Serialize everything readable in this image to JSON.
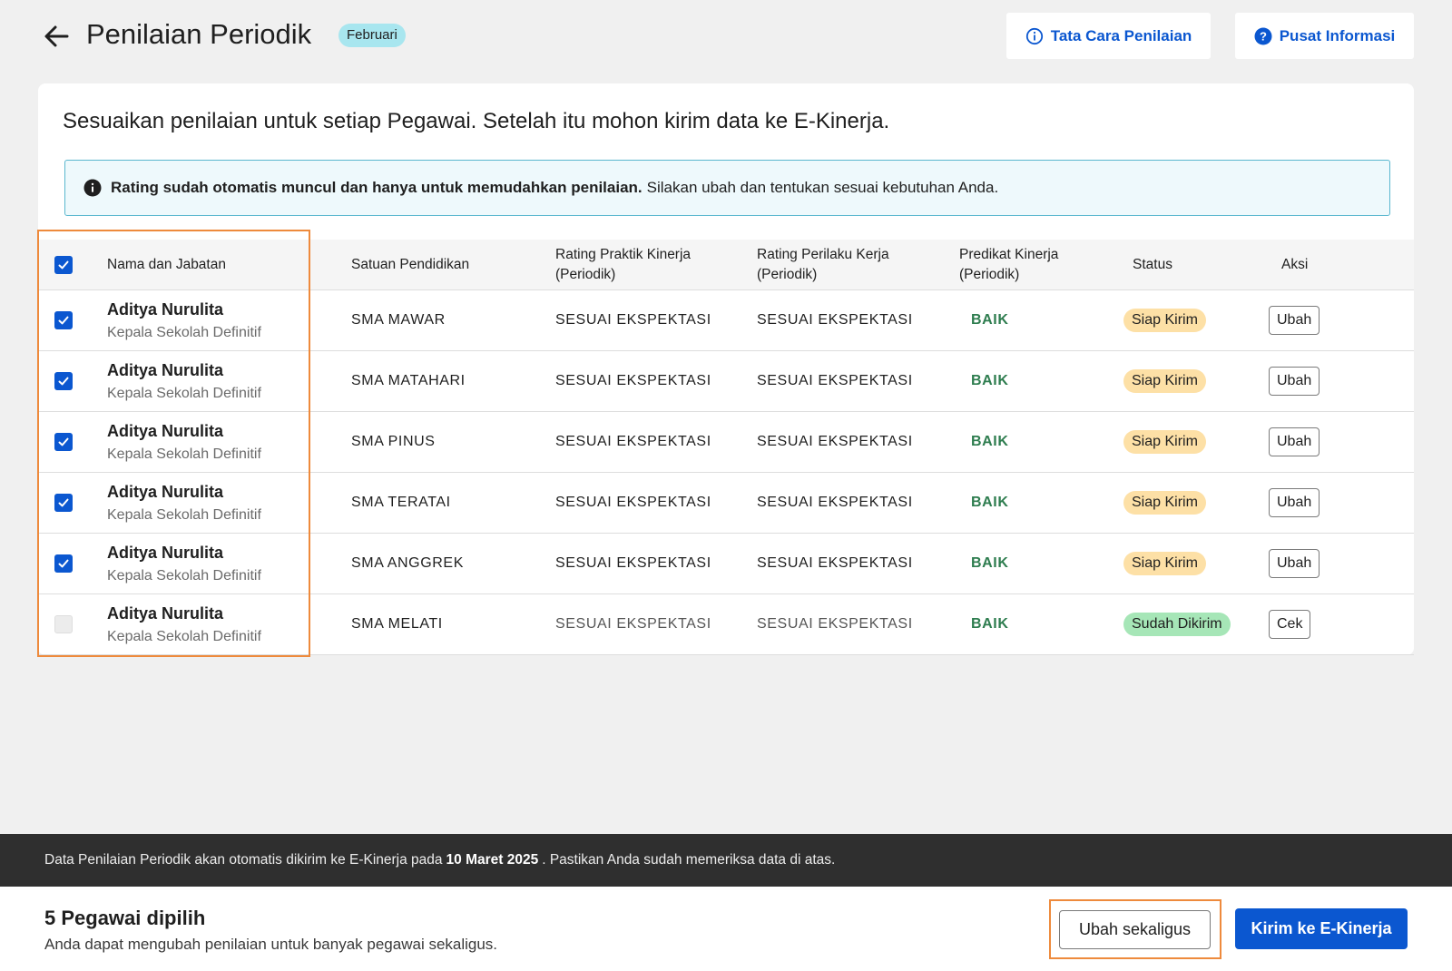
{
  "header": {
    "title": "Penilaian Periodik",
    "month_badge": "Februari",
    "tata_cara_label": "Tata Cara Penilaian",
    "pusat_informasi_label": "Pusat Informasi"
  },
  "card": {
    "heading": "Sesuaikan penilaian untuk setiap Pegawai. Setelah itu mohon kirim data ke E-Kinerja.",
    "info_bold": "Rating sudah otomatis muncul dan hanya untuk memudahkan penilaian.",
    "info_rest": "Silakan ubah dan tentukan sesuai kebutuhan Anda."
  },
  "table": {
    "headers": {
      "nama": "Nama dan Jabatan",
      "satuan": "Satuan Pendidikan",
      "rating_praktik_1": "Rating Praktik Kinerja",
      "rating_praktik_2": "(Periodik)",
      "rating_perilaku_1": "Rating Perilaku Kerja",
      "rating_perilaku_2": "(Periodik)",
      "predikat_1": "Predikat Kinerja",
      "predikat_2": "(Periodik)",
      "status": "Status",
      "aksi": "Aksi"
    },
    "header_checked": true,
    "rows": [
      {
        "name": "Aditya Nurulita",
        "role": "Kepala Sekolah Definitif",
        "school": "SMA MAWAR",
        "rating_praktik": "SESUAI EKSPEKTASI",
        "rating_perilaku": "SESUAI EKSPEKTASI",
        "predikat": "BAIK",
        "status": "Siap Kirim",
        "action": "Ubah",
        "checked": true
      },
      {
        "name": "Aditya Nurulita",
        "role": "Kepala Sekolah Definitif",
        "school": "SMA MATAHARI",
        "rating_praktik": "SESUAI EKSPEKTASI",
        "rating_perilaku": "SESUAI EKSPEKTASI",
        "predikat": "BAIK",
        "status": "Siap Kirim",
        "action": "Ubah",
        "checked": true
      },
      {
        "name": "Aditya Nurulita",
        "role": "Kepala Sekolah Definitif",
        "school": "SMA PINUS",
        "rating_praktik": "SESUAI EKSPEKTASI",
        "rating_perilaku": "SESUAI EKSPEKTASI",
        "predikat": "BAIK",
        "status": "Siap Kirim",
        "action": "Ubah",
        "checked": true
      },
      {
        "name": "Aditya Nurulita",
        "role": "Kepala Sekolah Definitif",
        "school": "SMA TERATAI",
        "rating_praktik": "SESUAI EKSPEKTASI",
        "rating_perilaku": "SESUAI EKSPEKTASI",
        "predikat": "BAIK",
        "status": "Siap Kirim",
        "action": "Ubah",
        "checked": true
      },
      {
        "name": "Aditya Nurulita",
        "role": "Kepala Sekolah Definitif",
        "school": "SMA ANGGREK",
        "rating_praktik": "SESUAI EKSPEKTASI",
        "rating_perilaku": "SESUAI EKSPEKTASI",
        "predikat": "BAIK",
        "status": "Siap Kirim",
        "action": "Ubah",
        "checked": true
      },
      {
        "name": "Aditya Nurulita",
        "role": "Kepala Sekolah Definitif",
        "school": "SMA MELATI",
        "rating_praktik": "SESUAI EKSPEKTASI",
        "rating_perilaku": "SESUAI EKSPEKTASI",
        "predikat": "BAIK",
        "status": "Sudah Dikirim",
        "action": "Cek",
        "checked": false
      }
    ]
  },
  "footer": {
    "notice_pre": "Data Penilaian Periodik akan otomatis dikirim ke E-Kinerja pada",
    "notice_date": "10 Maret 2025",
    "notice_post": ". Pastikan Anda sudah memeriksa data di atas.",
    "selected_count": "5 Pegawai dipilih",
    "selected_hint": "Anda dapat mengubah penilaian untuk banyak pegawai sekaligus.",
    "ubah_sekaligus_label": "Ubah sekaligus",
    "kirim_label": "Kirim ke E-Kinerja"
  },
  "colors": {
    "primary": "#0b57d0",
    "predikat_green": "#2e7d4f",
    "siap_kirim_bg": "#fde0a6",
    "sudah_dikirim_bg": "#a6e6b7",
    "highlight_orange": "#ee8a3c",
    "info_bg": "#eef9fc",
    "notice_bg": "#2f2f2f"
  },
  "icons": {
    "back": "arrow-left-icon",
    "tata_cara": "info-circle-icon",
    "pusat_informasi": "question-circle-icon",
    "info_box": "info-filled-icon",
    "checkbox": "checkmark-icon"
  }
}
